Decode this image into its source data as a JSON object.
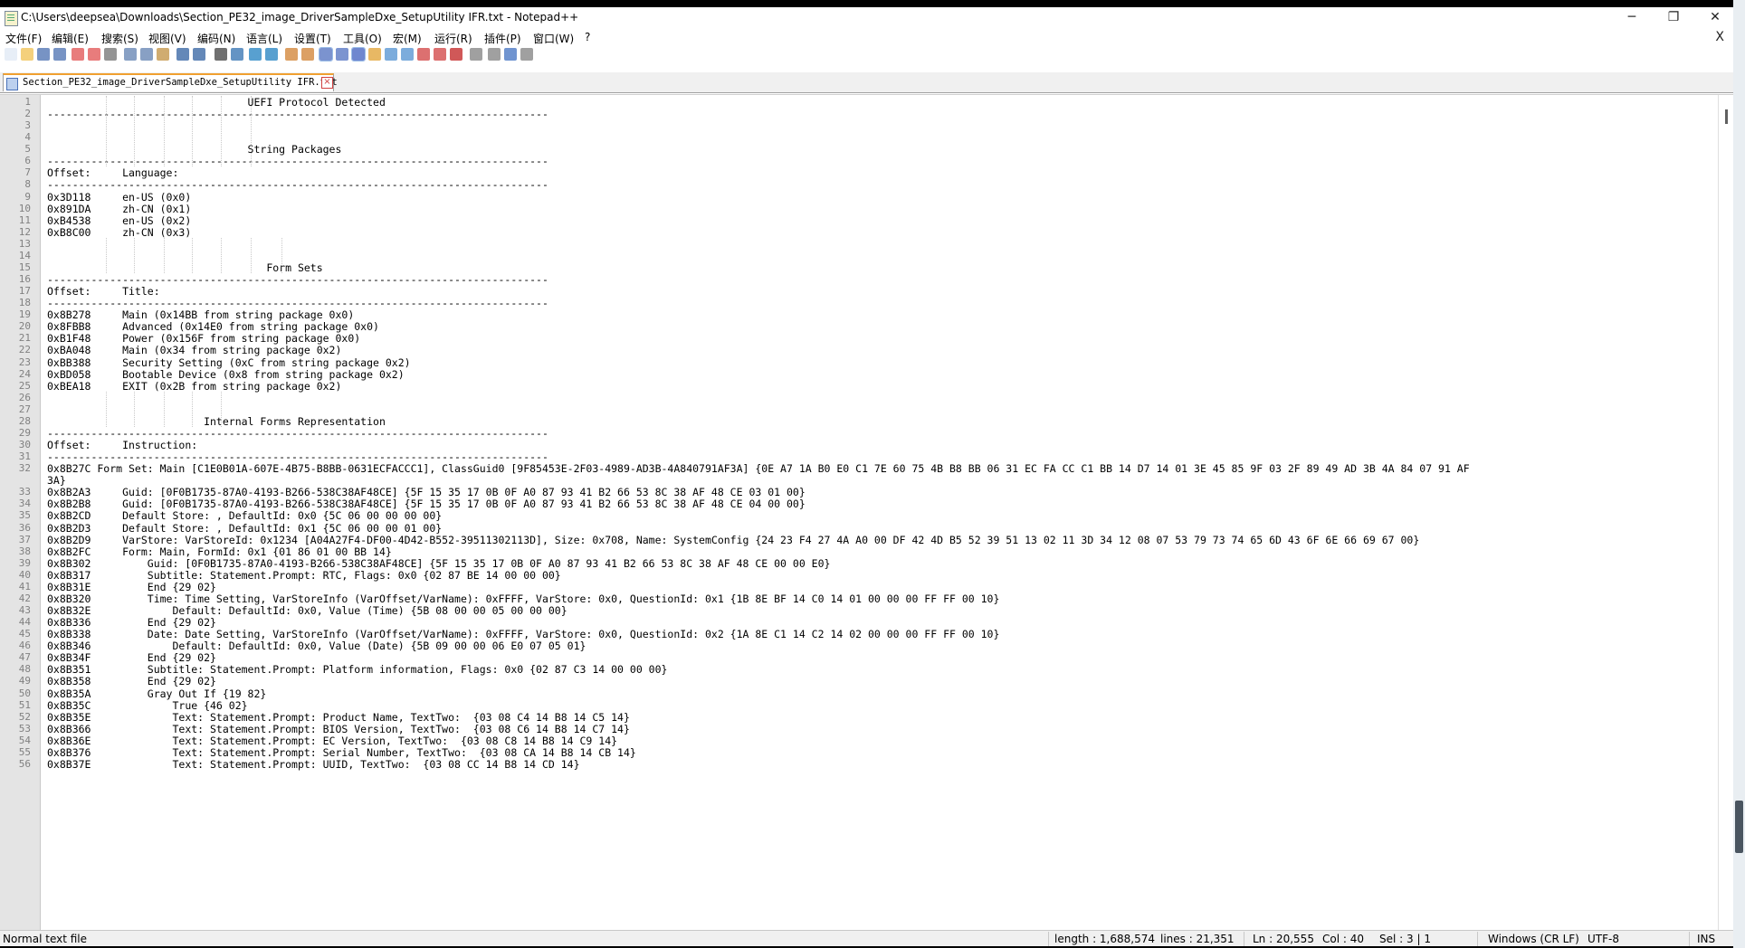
{
  "window": {
    "title": "C:\\Users\\deepsea\\Downloads\\Section_PE32_image_DriverSampleDxe_SetupUtility IFR.txt - Notepad++",
    "minimize": "─",
    "restore": "❐",
    "close": "✕"
  },
  "menu": {
    "items": [
      "文件(F)",
      "编辑(E)",
      "搜索(S)",
      "视图(V)",
      "编码(N)",
      "语言(L)",
      "设置(T)",
      "工具(O)",
      "宏(M)",
      "运行(R)",
      "插件(P)",
      "窗口(W)",
      "?"
    ],
    "close_doc": "X"
  },
  "toolbar": {
    "icons": [
      "new-file-icon",
      "open-file-icon",
      "save-icon",
      "save-all-icon",
      "close-icon",
      "close-all-icon",
      "print-icon",
      "cut-icon",
      "copy-icon",
      "paste-icon",
      "undo-icon",
      "redo-icon",
      "find-icon",
      "replace-icon",
      "zoom-in-icon",
      "zoom-out-icon",
      "sync-vertical-icon",
      "sync-horizontal-icon",
      "word-wrap-icon",
      "show-all-chars-icon",
      "indent-guide-icon",
      "define-language-icon",
      "document-map-icon",
      "function-list-icon",
      "folder-workspace-icon",
      "monitoring-icon",
      "record-macro-icon",
      "stop-macro-icon",
      "play-macro-icon",
      "run-macro-multiple-icon",
      "save-macro-icon"
    ]
  },
  "tab": {
    "label": "Section_PE32_image_DriverSampleDxe_SetupUtility IFR.txt",
    "close": "×"
  },
  "editor": {
    "lines": [
      {
        "n": "1",
        "text": "                                UEFI Protocol Detected"
      },
      {
        "n": "2",
        "text": "--------------------------------------------------------------------------------"
      },
      {
        "n": "3",
        "text": ""
      },
      {
        "n": "4",
        "text": ""
      },
      {
        "n": "5",
        "text": "                                String Packages"
      },
      {
        "n": "6",
        "text": "--------------------------------------------------------------------------------"
      },
      {
        "n": "7",
        "text": "Offset:     Language:"
      },
      {
        "n": "8",
        "text": "--------------------------------------------------------------------------------"
      },
      {
        "n": "9",
        "text": "0x3D118     en-US (0x0)"
      },
      {
        "n": "10",
        "text": "0x891DA     zh-CN (0x1)"
      },
      {
        "n": "11",
        "text": "0xB4538     en-US (0x2)"
      },
      {
        "n": "12",
        "text": "0xB8C00     zh-CN (0x3)"
      },
      {
        "n": "13",
        "text": ""
      },
      {
        "n": "14",
        "text": ""
      },
      {
        "n": "15",
        "text": "                                   Form Sets"
      },
      {
        "n": "16",
        "text": "--------------------------------------------------------------------------------"
      },
      {
        "n": "17",
        "text": "Offset:     Title:"
      },
      {
        "n": "18",
        "text": "--------------------------------------------------------------------------------"
      },
      {
        "n": "19",
        "text": "0x8B278     Main (0x14BB from string package 0x0)"
      },
      {
        "n": "20",
        "text": "0x8FBB8     Advanced (0x14E0 from string package 0x0)"
      },
      {
        "n": "21",
        "text": "0xB1F48     Power (0x156F from string package 0x0)"
      },
      {
        "n": "22",
        "text": "0xBA048     Main (0x34 from string package 0x2)"
      },
      {
        "n": "23",
        "text": "0xBB388     Security Setting (0xC from string package 0x2)"
      },
      {
        "n": "24",
        "text": "0xBD058     Bootable Device (0x8 from string package 0x2)"
      },
      {
        "n": "25",
        "text": "0xBEA18     EXIT (0x2B from string package 0x2)"
      },
      {
        "n": "26",
        "text": ""
      },
      {
        "n": "27",
        "text": ""
      },
      {
        "n": "28",
        "text": "                         Internal Forms Representation"
      },
      {
        "n": "29",
        "text": "--------------------------------------------------------------------------------"
      },
      {
        "n": "30",
        "text": "Offset:     Instruction:"
      },
      {
        "n": "31",
        "text": "--------------------------------------------------------------------------------"
      },
      {
        "n": "32",
        "text": "0x8B27C Form Set: Main [C1E0B01A-607E-4B75-B8BB-0631ECFACCC1], ClassGuid0 [9F85453E-2F03-4989-AD3B-4A840791AF3A] {0E A7 1A B0 E0 C1 7E 60 75 4B B8 BB 06 31 EC FA CC C1 BB 14 D7 14 01 3E 45 85 9F 03 2F 89 49 AD 3B 4A 84 07 91 AF"
      },
      {
        "n": "",
        "text": "3A}"
      },
      {
        "n": "33",
        "text": "0x8B2A3     Guid: [0F0B1735-87A0-4193-B266-538C38AF48CE] {5F 15 35 17 0B 0F A0 87 93 41 B2 66 53 8C 38 AF 48 CE 03 01 00}"
      },
      {
        "n": "34",
        "text": "0x8B2B8     Guid: [0F0B1735-87A0-4193-B266-538C38AF48CE] {5F 15 35 17 0B 0F A0 87 93 41 B2 66 53 8C 38 AF 48 CE 04 00 00}"
      },
      {
        "n": "35",
        "text": "0x8B2CD     Default Store: , DefaultId: 0x0 {5C 06 00 00 00 00}"
      },
      {
        "n": "36",
        "text": "0x8B2D3     Default Store: , DefaultId: 0x1 {5C 06 00 00 01 00}"
      },
      {
        "n": "37",
        "text": "0x8B2D9     VarStore: VarStoreId: 0x1234 [A04A27F4-DF00-4D42-B552-39511302113D], Size: 0x708, Name: SystemConfig {24 23 F4 27 4A A0 00 DF 42 4D B5 52 39 51 13 02 11 3D 34 12 08 07 53 79 73 74 65 6D 43 6F 6E 66 69 67 00}"
      },
      {
        "n": "38",
        "text": "0x8B2FC     Form: Main, FormId: 0x1 {01 86 01 00 BB 14}"
      },
      {
        "n": "39",
        "text": "0x8B302         Guid: [0F0B1735-87A0-4193-B266-538C38AF48CE] {5F 15 35 17 0B 0F A0 87 93 41 B2 66 53 8C 38 AF 48 CE 00 00 E0}"
      },
      {
        "n": "40",
        "text": "0x8B317         Subtitle: Statement.Prompt: RTC, Flags: 0x0 {02 87 BE 14 00 00 00}"
      },
      {
        "n": "41",
        "text": "0x8B31E         End {29 02}"
      },
      {
        "n": "42",
        "text": "0x8B320         Time: Time Setting, VarStoreInfo (VarOffset/VarName): 0xFFFF, VarStore: 0x0, QuestionId: 0x1 {1B 8E BF 14 C0 14 01 00 00 00 FF FF 00 10}"
      },
      {
        "n": "43",
        "text": "0x8B32E             Default: DefaultId: 0x0, Value (Time) {5B 08 00 00 05 00 00 00}"
      },
      {
        "n": "44",
        "text": "0x8B336         End {29 02}"
      },
      {
        "n": "45",
        "text": "0x8B338         Date: Date Setting, VarStoreInfo (VarOffset/VarName): 0xFFFF, VarStore: 0x0, QuestionId: 0x2 {1A 8E C1 14 C2 14 02 00 00 00 FF FF 00 10}"
      },
      {
        "n": "46",
        "text": "0x8B346             Default: DefaultId: 0x0, Value (Date) {5B 09 00 00 06 E0 07 05 01}"
      },
      {
        "n": "47",
        "text": "0x8B34F         End {29 02}"
      },
      {
        "n": "48",
        "text": "0x8B351         Subtitle: Statement.Prompt: Platform information, Flags: 0x0 {02 87 C3 14 00 00 00}"
      },
      {
        "n": "49",
        "text": "0x8B358         End {29 02}"
      },
      {
        "n": "50",
        "text": "0x8B35A         Gray Out If {19 82}"
      },
      {
        "n": "51",
        "text": "0x8B35C             True {46 02}"
      },
      {
        "n": "52",
        "text": "0x8B35E             Text: Statement.Prompt: Product Name, TextTwo:  {03 08 C4 14 B8 14 C5 14}"
      },
      {
        "n": "53",
        "text": "0x8B366             Text: Statement.Prompt: BIOS Version, TextTwo:  {03 08 C6 14 B8 14 C7 14}"
      },
      {
        "n": "54",
        "text": "0x8B36E             Text: Statement.Prompt: EC Version, TextTwo:  {03 08 C8 14 B8 14 C9 14}"
      },
      {
        "n": "55",
        "text": "0x8B376             Text: Statement.Prompt: Serial Number, TextTwo:  {03 08 CA 14 B8 14 CB 14}"
      },
      {
        "n": "56",
        "text": "0x8B37E             Text: Statement.Prompt: UUID, TextTwo:  {03 08 CC 14 B8 14 CD 14}"
      }
    ]
  },
  "status": {
    "type": "Normal text file",
    "length": "length : 1,688,574",
    "lines": "lines : 21,351",
    "ln": "Ln : 20,555",
    "col": "Col : 40",
    "sel": "Sel : 3 | 1",
    "eol": "Windows (CR LF)",
    "encoding": "UTF-8",
    "mode": "INS"
  }
}
